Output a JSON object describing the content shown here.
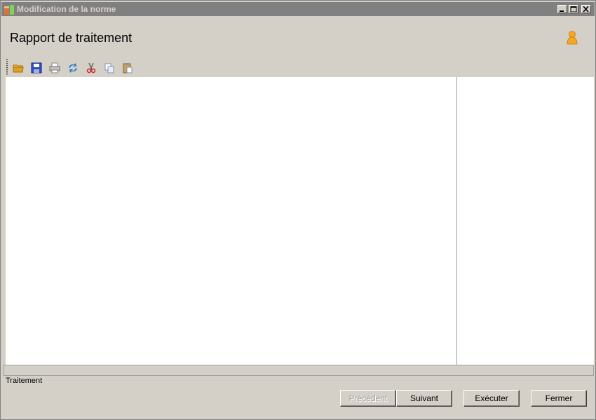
{
  "window": {
    "title": "Modification de la norme",
    "controls": [
      "minimize-icon",
      "maximize-icon",
      "close-icon"
    ]
  },
  "header": {
    "title": "Rapport de traitement",
    "user_icon": "user-icon"
  },
  "toolbar": {
    "items": [
      {
        "name": "open-folder-icon"
      },
      {
        "name": "save-icon"
      },
      {
        "name": "print-icon"
      },
      {
        "name": "refresh-icon"
      },
      {
        "name": "cut-icon"
      },
      {
        "name": "copy-icon"
      },
      {
        "name": "paste-icon"
      }
    ]
  },
  "group": {
    "label": "Traitement"
  },
  "buttons": {
    "previous": "Précédent",
    "next": "Suivant",
    "execute": "Exécuter",
    "close": "Fermer"
  },
  "colors": {
    "background": "#d4d0c8",
    "titlebar": "#808080",
    "title_text": "#d4d0c8",
    "content": "#ffffff",
    "disabled_text": "#a0a0a0"
  }
}
